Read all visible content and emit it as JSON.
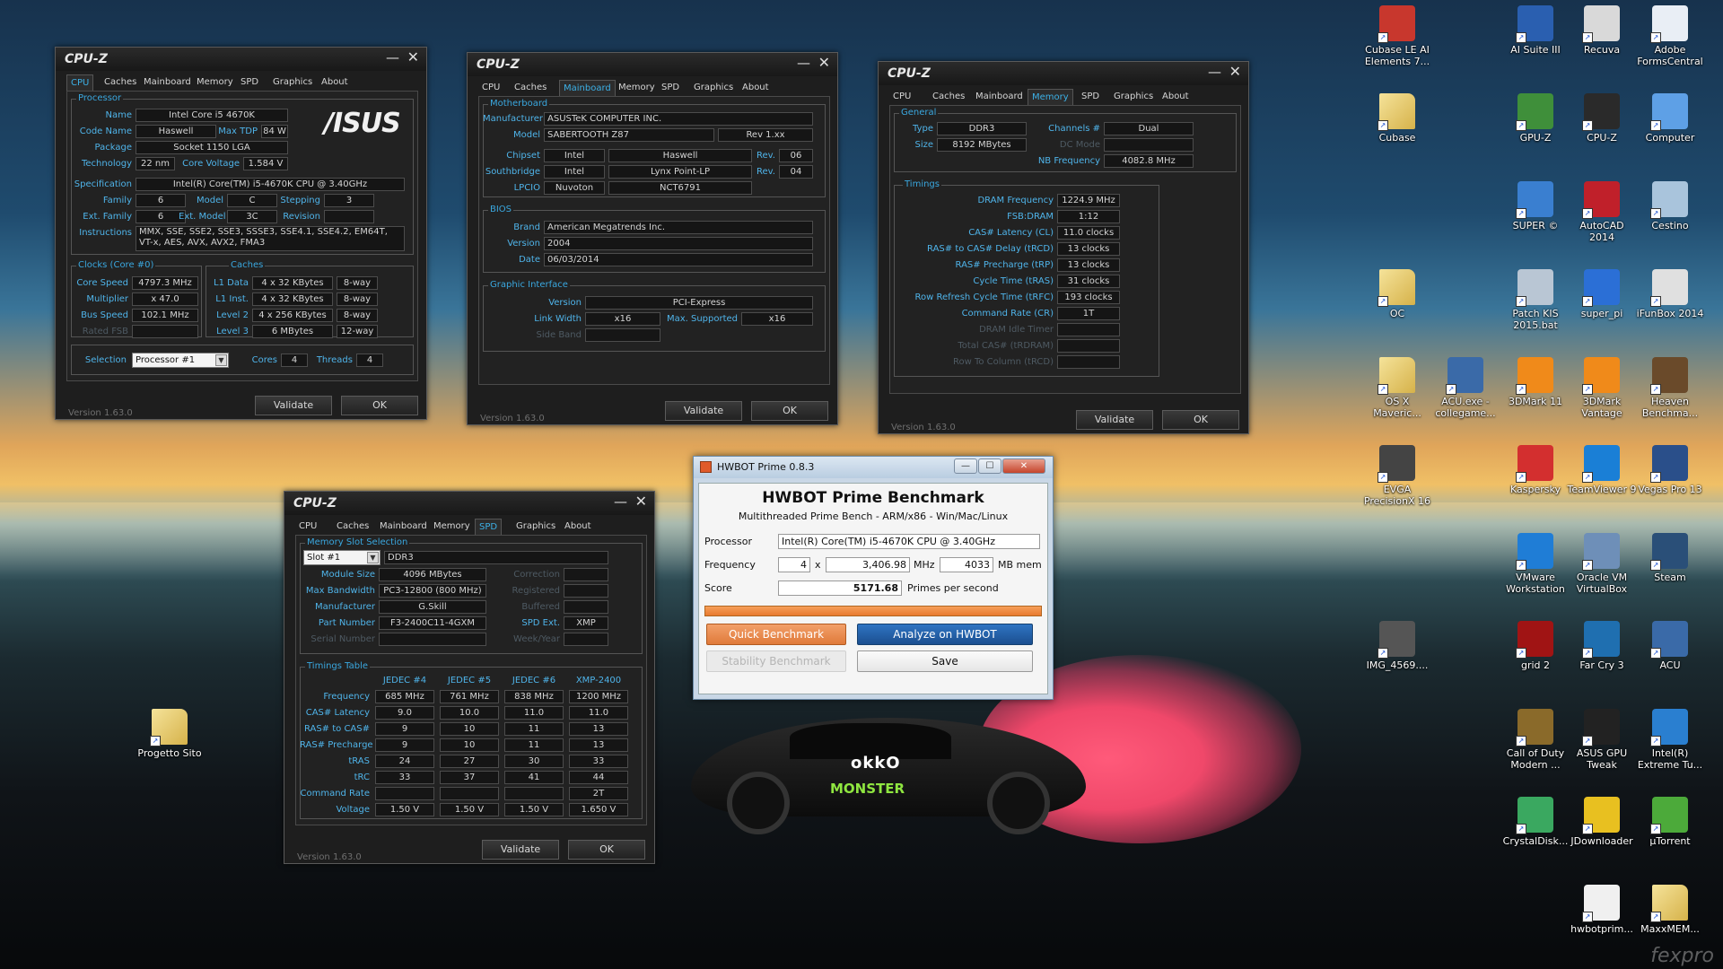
{
  "cpuz_app": {
    "title": "CPU-Z",
    "tabs": [
      "CPU",
      "Caches",
      "Mainboard",
      "Memory",
      "SPD",
      "Graphics",
      "About"
    ],
    "version": "Version 1.63.0",
    "validate": "Validate",
    "ok": "OK",
    "minimize": "—",
    "close": "✕"
  },
  "cpu": {
    "processor_group": "Processor",
    "name_label": "Name",
    "name": "Intel Core i5 4670K",
    "codename_label": "Code Name",
    "codename": "Haswell",
    "maxtdp_label": "Max TDP",
    "maxtdp": "84 W",
    "package_label": "Package",
    "package": "Socket 1150 LGA",
    "technology_label": "Technology",
    "technology": "22 nm",
    "corevoltage_label": "Core Voltage",
    "corevoltage": "1.584 V",
    "spec_label": "Specification",
    "spec": "Intel(R) Core(TM) i5-4670K CPU @ 3.40GHz",
    "family_label": "Family",
    "family": "6",
    "model_label": "Model",
    "model": "C",
    "stepping_label": "Stepping",
    "stepping": "3",
    "extfamily_label": "Ext. Family",
    "extfamily": "6",
    "extmodel_label": "Ext. Model",
    "extmodel": "3C",
    "revision_label": "Revision",
    "revision": "",
    "instructions_label": "Instructions",
    "instructions": "MMX, SSE, SSE2, SSE3, SSSE3, SSE4.1, SSE4.2, EM64T, VT-x, AES, AVX, AVX2, FMA3",
    "logo": "/ISUS",
    "clocks_group": "Clocks (Core #0)",
    "corespeed_label": "Core Speed",
    "corespeed": "4797.3 MHz",
    "multiplier_label": "Multiplier",
    "multiplier": "x 47.0",
    "busspeed_label": "Bus Speed",
    "busspeed": "102.1 MHz",
    "ratedfsb_label": "Rated FSB",
    "ratedfsb": "",
    "caches_group": "Caches",
    "l1data_label": "L1 Data",
    "l1data": "4 x 32 KBytes",
    "l1data_way": "8-way",
    "l1inst_label": "L1 Inst.",
    "l1inst": "4 x 32 KBytes",
    "l1inst_way": "8-way",
    "l2_label": "Level 2",
    "l2": "4 x 256 KBytes",
    "l2_way": "8-way",
    "l3_label": "Level 3",
    "l3": "6 MBytes",
    "l3_way": "12-way",
    "selection_label": "Selection",
    "selection": "Processor #1",
    "cores_label": "Cores",
    "cores": "4",
    "threads_label": "Threads",
    "threads": "4"
  },
  "mainboard": {
    "mb_group": "Motherboard",
    "manufacturer_label": "Manufacturer",
    "manufacturer": "ASUSTeK COMPUTER INC.",
    "model_label": "Model",
    "model": "SABERTOOTH Z87",
    "model_rev": "Rev 1.xx",
    "chipset_label": "Chipset",
    "chipset_vendor": "Intel",
    "chipset": "Haswell",
    "chipset_rev_label": "Rev.",
    "chipset_rev": "06",
    "southbridge_label": "Southbridge",
    "sb_vendor": "Intel",
    "sb": "Lynx Point-LP",
    "sb_rev_label": "Rev.",
    "sb_rev": "04",
    "lpcio_label": "LPCIO",
    "lpcio_vendor": "Nuvoton",
    "lpcio": "NCT6791",
    "bios_group": "BIOS",
    "brand_label": "Brand",
    "brand": "American Megatrends Inc.",
    "version_label": "Version",
    "version": "2004",
    "date_label": "Date",
    "date": "06/03/2014",
    "gi_group": "Graphic Interface",
    "gi_version_label": "Version",
    "gi_version": "PCI-Express",
    "linkwidth_label": "Link Width",
    "linkwidth": "x16",
    "maxsupported_label": "Max. Supported",
    "maxsupported": "x16",
    "sideband_label": "Side Band",
    "sideband": ""
  },
  "memory": {
    "general_group": "General",
    "type_label": "Type",
    "type": "DDR3",
    "channels_label": "Channels #",
    "channels": "Dual",
    "size_label": "Size",
    "size": "8192 MBytes",
    "dcmode_label": "DC Mode",
    "dcmode": "",
    "nbfreq_label": "NB Frequency",
    "nbfreq": "4082.8 MHz",
    "timings_group": "Timings",
    "rows": [
      {
        "label": "DRAM Frequency",
        "value": "1224.9 MHz",
        "dim": false
      },
      {
        "label": "FSB:DRAM",
        "value": "1:12",
        "dim": false
      },
      {
        "label": "CAS# Latency (CL)",
        "value": "11.0 clocks",
        "dim": false
      },
      {
        "label": "RAS# to CAS# Delay (tRCD)",
        "value": "13 clocks",
        "dim": false
      },
      {
        "label": "RAS# Precharge (tRP)",
        "value": "13 clocks",
        "dim": false
      },
      {
        "label": "Cycle Time (tRAS)",
        "value": "31 clocks",
        "dim": false
      },
      {
        "label": "Row Refresh Cycle Time (tRFC)",
        "value": "193 clocks",
        "dim": false
      },
      {
        "label": "Command Rate (CR)",
        "value": "1T",
        "dim": false
      },
      {
        "label": "DRAM Idle Timer",
        "value": "",
        "dim": true
      },
      {
        "label": "Total CAS# (tRDRAM)",
        "value": "",
        "dim": true
      },
      {
        "label": "Row To Column (tRCD)",
        "value": "",
        "dim": true
      }
    ]
  },
  "spd": {
    "slot_group": "Memory Slot Selection",
    "slot": "Slot #1",
    "slot_type": "DDR3",
    "modulesize_label": "Module Size",
    "modulesize": "4096 MBytes",
    "maxbw_label": "Max Bandwidth",
    "maxbw": "PC3-12800 (800 MHz)",
    "manufacturer_label": "Manufacturer",
    "manufacturer": "G.Skill",
    "partnumber_label": "Part Number",
    "partnumber": "F3-2400C11-4GXM",
    "serial_label": "Serial Number",
    "serial": "",
    "correction_label": "Correction",
    "registered_label": "Registered",
    "buffered_label": "Buffered",
    "spdext_label": "SPD Ext.",
    "spdext": "XMP",
    "weekyear_label": "Week/Year",
    "timings_group": "Timings Table",
    "cols": [
      "JEDEC #4",
      "JEDEC #5",
      "JEDEC #6",
      "XMP-2400"
    ],
    "rows": [
      {
        "label": "Frequency",
        "values": [
          "685 MHz",
          "761 MHz",
          "838 MHz",
          "1200 MHz"
        ]
      },
      {
        "label": "CAS# Latency",
        "values": [
          "9.0",
          "10.0",
          "11.0",
          "11.0"
        ]
      },
      {
        "label": "RAS# to CAS#",
        "values": [
          "9",
          "10",
          "11",
          "13"
        ]
      },
      {
        "label": "RAS# Precharge",
        "values": [
          "9",
          "10",
          "11",
          "13"
        ]
      },
      {
        "label": "tRAS",
        "values": [
          "24",
          "27",
          "30",
          "33"
        ]
      },
      {
        "label": "tRC",
        "values": [
          "33",
          "37",
          "41",
          "44"
        ]
      },
      {
        "label": "Command Rate",
        "values": [
          "",
          "",
          "",
          "2T"
        ]
      },
      {
        "label": "Voltage",
        "values": [
          "1.50 V",
          "1.50 V",
          "1.50 V",
          "1.650 V"
        ]
      }
    ]
  },
  "hwbot": {
    "window_title": "HWBOT Prime 0.8.3",
    "heading": "HWBOT Prime Benchmark",
    "subheading": "Multithreaded Prime Bench - ARM/x86 - Win/Mac/Linux",
    "processor_label": "Processor",
    "processor": "Intel(R) Core(TM) i5-4670K CPU @ 3.40GHz",
    "frequency_label": "Frequency",
    "threads": "4",
    "times": "x",
    "frequency": "3,406.98",
    "mhz": "MHz",
    "mem": "4033",
    "mbmem": "MB mem",
    "score_label": "Score",
    "score": "5171.68",
    "pps": "Primes per second",
    "progress": 1.0,
    "quick": "Quick Benchmark",
    "analyze": "Analyze on HWBOT",
    "stability": "Stability Benchmark",
    "save": "Save",
    "btn_min": "—",
    "btn_max": "☐",
    "btn_close": "✕",
    "accent": "#e8792f",
    "blue": "#1e5fa8"
  },
  "desktop": {
    "icons": [
      {
        "label": "Cubase LE AI Elements 7...",
        "color": "#c8372d"
      },
      {
        "label": "AI Suite III",
        "color": "#2a5fb0"
      },
      {
        "label": "Recuva",
        "color": "#d9d9d9"
      },
      {
        "label": "Adobe FormsCentral",
        "color": "#e9eef5"
      },
      {
        "label": "Cubase",
        "color": "folder"
      },
      {
        "label": "GPU-Z",
        "color": "#3f8f3a"
      },
      {
        "label": "CPU-Z",
        "color": "#2a2a2a"
      },
      {
        "label": "Computer",
        "color": "#5ea0e6"
      },
      {
        "label": "SUPER ©",
        "color": "#3a7fd0"
      },
      {
        "label": "AutoCAD 2014",
        "color": "#c0202a"
      },
      {
        "label": "Cestino",
        "color": "#a9c4dc"
      },
      {
        "label": "OC",
        "color": "folder"
      },
      {
        "label": "Patch KIS 2015.bat",
        "color": "#b9c6d4"
      },
      {
        "label": "super_pi",
        "color": "#2b6fd6"
      },
      {
        "label": "iFunBox 2014",
        "color": "#e0e0e0"
      },
      {
        "label": "OS X Maveric...",
        "color": "folder"
      },
      {
        "label": "ACU.exe - collegame...",
        "color": "#3a6aa8"
      },
      {
        "label": "3DMark 11",
        "color": "#f08a1a"
      },
      {
        "label": "3DMark Vantage",
        "color": "#f08a1a"
      },
      {
        "label": "Heaven Benchma...",
        "color": "#6a4a2a"
      },
      {
        "label": "EVGA PrecisionX 16",
        "color": "#444"
      },
      {
        "label": "Kaspersky",
        "color": "#d32f2f"
      },
      {
        "label": "TeamViewer 9",
        "color": "#1a7fd6"
      },
      {
        "label": "Vegas Pro 13",
        "color": "#2a4f8a"
      },
      {
        "label": "VMware Workstation",
        "color": "#1f7dd6"
      },
      {
        "label": "Oracle VM VirtualBox",
        "color": "#6e8fb8"
      },
      {
        "label": "Steam",
        "color": "#2a4f78"
      },
      {
        "label": "IMG_4569....",
        "color": "#555"
      },
      {
        "label": "grid 2",
        "color": "#a01414"
      },
      {
        "label": "Far Cry 3",
        "color": "#1f6fb0"
      },
      {
        "label": "ACU",
        "color": "#3a6aa8"
      },
      {
        "label": "Progetto Sito",
        "color": "folder"
      },
      {
        "label": "Call of Duty Modern ...",
        "color": "#8a6a2a"
      },
      {
        "label": "ASUS GPU Tweak",
        "color": "#222"
      },
      {
        "label": "Intel(R) Extreme Tu...",
        "color": "#2a7fd0"
      },
      {
        "label": "CrystalDisk...",
        "color": "#3aa860"
      },
      {
        "label": "JDownloader",
        "color": "#e8c020"
      },
      {
        "label": "µTorrent",
        "color": "#4caa3a"
      },
      {
        "label": "hwbotprim...",
        "color": "#f0f0f0"
      },
      {
        "label": "MaxxMEM...",
        "color": "folder"
      }
    ],
    "watermark": "fexpro"
  }
}
